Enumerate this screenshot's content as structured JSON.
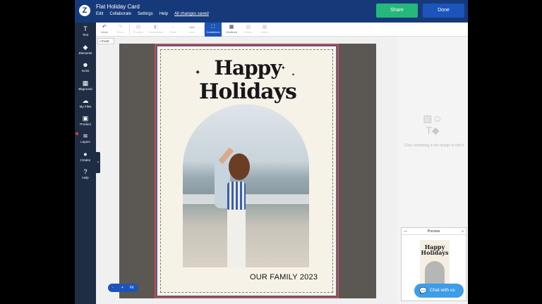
{
  "app": {
    "title": "Flat Holiday Card",
    "menu": [
      "Edit",
      "Collaborate",
      "Settings",
      "Help"
    ],
    "save_status": "All changes saved",
    "share_label": "Share",
    "done_label": "Done"
  },
  "sidebar": {
    "items": [
      {
        "label": "Text",
        "icon": "T"
      },
      {
        "label": "Elements",
        "icon": "◆"
      },
      {
        "label": "Icons",
        "icon": "☻"
      },
      {
        "label": "Bkground",
        "icon": "▦"
      },
      {
        "label": "My Files",
        "icon": "☁"
      },
      {
        "label": "Product",
        "icon": "▣"
      },
      {
        "label": "Layers",
        "icon": "≋"
      },
      {
        "label": "Creator",
        "icon": "●"
      },
      {
        "label": "Help",
        "icon": "?"
      }
    ]
  },
  "toolbar": {
    "items": [
      {
        "label": "Undo",
        "icon": "↶"
      },
      {
        "label": "Redo",
        "icon": "↷"
      },
      {
        "label": "Position",
        "icon": "▤"
      },
      {
        "label": "Workspace",
        "icon": "◧"
      },
      {
        "label": "Paste",
        "icon": "▫"
      },
      {
        "label": "Lock",
        "icon": "▬"
      },
      {
        "label": "Guidelines",
        "icon": "⛶"
      },
      {
        "label": "Gridlines",
        "icon": "▦"
      },
      {
        "label": "Group",
        "icon": "▥"
      },
      {
        "label": "More",
        "icon": "▦"
      }
    ]
  },
  "canvas": {
    "side_tag": "Front",
    "card_line1": "Happy",
    "card_line2": "Holidays",
    "card_footer": "OUR FAMILY 2023"
  },
  "right_panel": {
    "empty_hint": "Click something in the design to edit it",
    "preview_title": "Preview",
    "chat_label": "Chat with us"
  },
  "zoom": {
    "minus": "-",
    "plus": "+",
    "fit": "Fit"
  }
}
